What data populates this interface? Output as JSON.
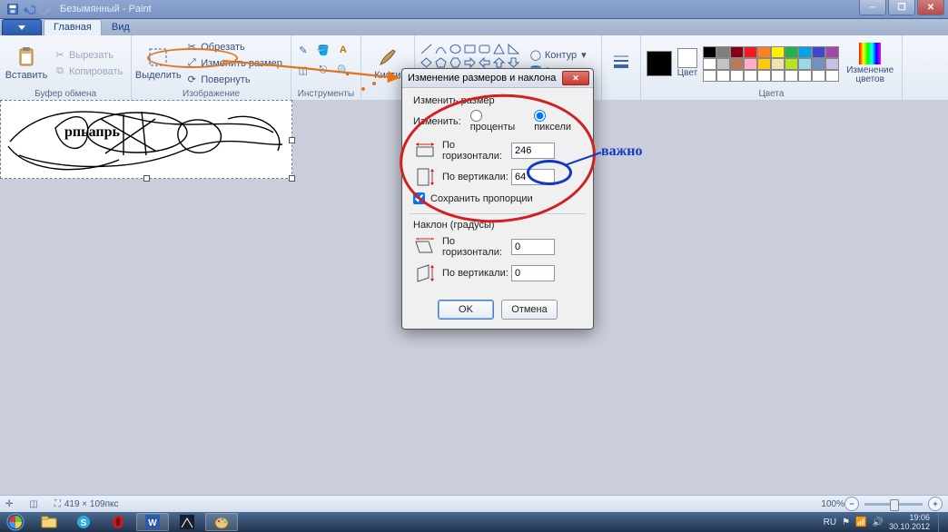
{
  "window": {
    "title": "Безымянный - Paint"
  },
  "tabs": {
    "home": "Главная",
    "view": "Вид"
  },
  "ribbon": {
    "clipboard": {
      "label": "Буфер обмена",
      "paste": "Вставить",
      "cut": "Вырезать",
      "copy": "Копировать"
    },
    "image": {
      "label": "Изображение",
      "select": "Выделить",
      "crop": "Обрезать",
      "resize": "Изменить размер",
      "rotate": "Повернуть"
    },
    "tools": {
      "label": "Инструменты"
    },
    "brushes": {
      "label": "Кисти"
    },
    "shapes": {
      "outline": "Контур",
      "fill": "Заливка"
    },
    "color_label": "Цвет",
    "colors_group": "Цвета",
    "editcolors": "Изменение цветов"
  },
  "canvas_text": "рпьапрь",
  "dialog": {
    "title": "Изменение размеров и наклона",
    "resize_section": "Изменить размер",
    "by_label": "Изменить:",
    "percent": "проценты",
    "pixels": "пиксели",
    "horiz": "По горизонтали:",
    "vert": "По вертикали:",
    "val_h": "246",
    "val_v": "64",
    "keep_aspect": "Сохранить пропорции",
    "skew_section": "Наклон (градусы)",
    "skew_h": "0",
    "skew_v": "0",
    "ok": "OK",
    "cancel": "Отмена"
  },
  "annot": {
    "important": "важно"
  },
  "status": {
    "dims": "419 × 109пкс",
    "zoom": "100%"
  },
  "taskbar": {
    "lang": "RU",
    "time": "19:06",
    "date": "30.10.2012"
  },
  "palette_row1": [
    "#000",
    "#7f7f7f",
    "#880015",
    "#ed1c24",
    "#ff7f27",
    "#fff200",
    "#22b14c",
    "#00a2e8",
    "#3f48cc",
    "#a349a4"
  ],
  "palette_row2": [
    "#fff",
    "#c3c3c3",
    "#b97a57",
    "#ffaec9",
    "#ffc90e",
    "#efe4b0",
    "#b5e61d",
    "#99d9ea",
    "#7092be",
    "#c8bfe7"
  ]
}
